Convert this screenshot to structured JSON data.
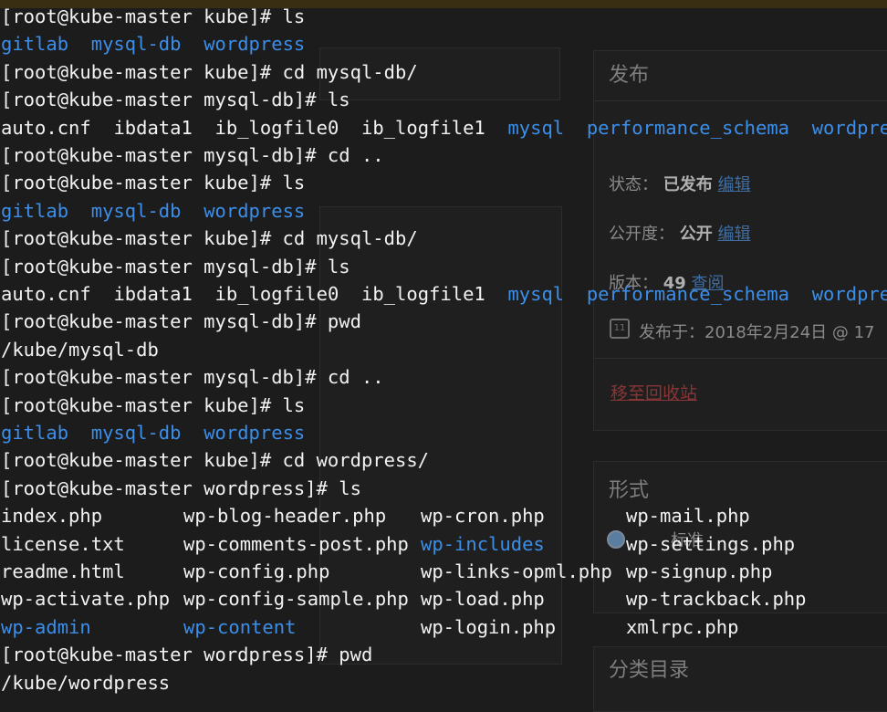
{
  "background_page": {
    "publish_box": {
      "title": "发布",
      "status_label": "状态：",
      "status_value": "已发布",
      "status_edit": "编辑",
      "visibility_label": "公开度：",
      "visibility_value": "公开",
      "visibility_edit": "编辑",
      "revisions_label": "版本：",
      "revisions_count": "49",
      "revisions_view": "查阅",
      "published_on": "发布于：2018年2月24日 @ 17",
      "trash_link": "移至回收站"
    },
    "format_box": {
      "title": "形式",
      "option": "标准"
    },
    "category_box": {
      "title": "分类目录"
    }
  },
  "terminal": {
    "lines": [
      {
        "type": "cmd",
        "text": "[root@kube-master kube]# ls"
      },
      {
        "type": "dirs",
        "items": [
          "gitlab",
          "mysql-db",
          "wordpress"
        ]
      },
      {
        "type": "cmd",
        "text": "[root@kube-master kube]# cd mysql-db/"
      },
      {
        "type": "cmd",
        "text": "[root@kube-master mysql-db]# ls"
      },
      {
        "type": "files",
        "files": [
          "auto.cnf",
          "ibdata1",
          "ib_logfile0",
          "ib_logfile1"
        ],
        "dirs": [
          "mysql",
          "performance_schema",
          "wordpress"
        ]
      },
      {
        "type": "cmd",
        "text": "[root@kube-master mysql-db]# cd .."
      },
      {
        "type": "cmd",
        "text": "[root@kube-master kube]# ls"
      },
      {
        "type": "dirs",
        "items": [
          "gitlab",
          "mysql-db",
          "wordpress"
        ]
      },
      {
        "type": "cmd",
        "text": "[root@kube-master kube]# cd mysql-db/"
      },
      {
        "type": "cmd",
        "text": "[root@kube-master mysql-db]# ls"
      },
      {
        "type": "files",
        "files": [
          "auto.cnf",
          "ibdata1",
          "ib_logfile0",
          "ib_logfile1"
        ],
        "dirs": [
          "mysql",
          "performance_schema",
          "wordpress"
        ]
      },
      {
        "type": "cmd",
        "text": "[root@kube-master mysql-db]# pwd"
      },
      {
        "type": "out",
        "text": "/kube/mysql-db"
      },
      {
        "type": "cmd",
        "text": "[root@kube-master mysql-db]# cd .."
      },
      {
        "type": "cmd",
        "text": "[root@kube-master kube]# ls"
      },
      {
        "type": "dirs",
        "items": [
          "gitlab",
          "mysql-db",
          "wordpress"
        ]
      },
      {
        "type": "cmd",
        "text": "[root@kube-master kube]# cd wordpress/"
      },
      {
        "type": "cmd",
        "text": "[root@kube-master wordpress]# ls"
      },
      {
        "type": "grid",
        "row": [
          "index.php",
          "wp-blog-header.php",
          "wp-cron.php",
          "wp-mail.php"
        ],
        "dir_cols": []
      },
      {
        "type": "grid",
        "row": [
          "license.txt",
          "wp-comments-post.php",
          "wp-includes",
          "wp-settings.php"
        ],
        "dir_cols": [
          2
        ]
      },
      {
        "type": "grid",
        "row": [
          "readme.html",
          "wp-config.php",
          "wp-links-opml.php",
          "wp-signup.php"
        ],
        "dir_cols": []
      },
      {
        "type": "grid",
        "row": [
          "wp-activate.php",
          "wp-config-sample.php",
          "wp-load.php",
          "wp-trackback.php"
        ],
        "dir_cols": []
      },
      {
        "type": "grid",
        "row": [
          "wp-admin",
          "wp-content",
          "wp-login.php",
          "xmlrpc.php"
        ],
        "dir_cols": [
          0,
          1
        ]
      },
      {
        "type": "cmd",
        "text": "[root@kube-master wordpress]# pwd"
      },
      {
        "type": "out",
        "text": "/kube/wordpress"
      }
    ]
  },
  "colors": {
    "terminal_bg": "#1c1c1c",
    "text": "#f2f2f2",
    "directory": "#3b8eea"
  }
}
